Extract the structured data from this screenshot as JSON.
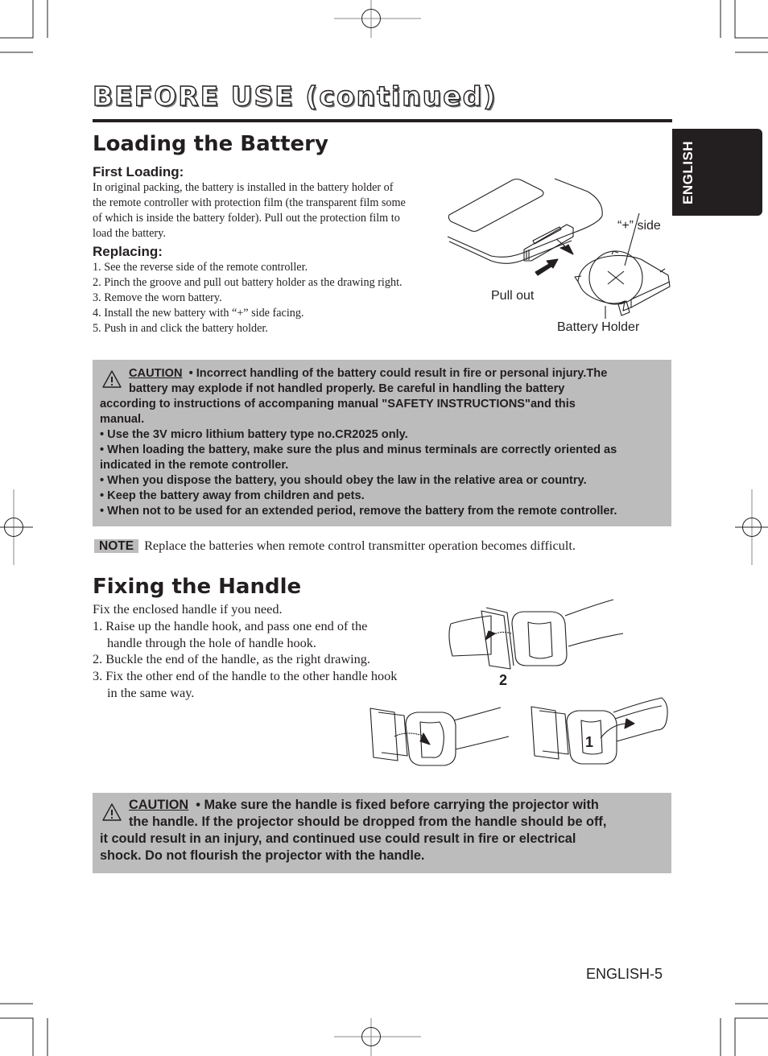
{
  "header": {
    "title": "BEFORE USE (continued)",
    "language_tab": "ENGLISH"
  },
  "battery_section": {
    "heading": "Loading the Battery",
    "first_loading": {
      "heading": "First Loading:",
      "lines": [
        "In original packing, the battery is installed in the battery holder of",
        "the remote controller with protection film (the transparent film some",
        "of which is inside the battery folder). Pull out the protection film  to",
        "load the battery."
      ]
    },
    "replacing": {
      "heading": "Replacing:",
      "steps": [
        "1. See the reverse side of the remote controller.",
        "2. Pinch the groove and pull out battery holder as the drawing right.",
        "3. Remove the worn battery.",
        "4. Install the new battery with “+” side facing.",
        "5. Push in and click the battery holder."
      ]
    },
    "figure": {
      "plus_side_label": "“+” side",
      "pull_out_label": "Pull out",
      "battery_holder_label": "Battery Holder"
    },
    "caution": {
      "label": "CAUTION",
      "lines": [
        "• Incorrect handling of the battery could result in fire or personal injury.The",
        "battery may explode if not handled properly. Be careful in handling the battery",
        "according to instructions of accompaning manual \"SAFETY INSTRUCTIONS\"and this",
        "manual.",
        "• Use the 3V micro lithium battery type no.CR2025 only.",
        "• When loading the battery, make sure the plus and minus terminals are correctly oriented as",
        "indicated in the remote controller.",
        "• When you dispose the battery, you should obey the law in the relative area or country.",
        "• Keep the battery away from children and pets.",
        "• When not to be used for an extended period, remove the battery from the remote controller."
      ]
    },
    "note": {
      "label": "NOTE",
      "text": "Replace the batteries when remote control transmitter operation becomes difficult."
    }
  },
  "handle_section": {
    "heading": "Fixing the Handle",
    "intro": "Fix the enclosed handle if you need.",
    "steps": [
      "1. Raise up the handle hook, and pass one end of the handle through the hole of handle hook.",
      "2. Buckle the end of the handle, as the right drawing.",
      "3. Fix the other end of the handle to the other handle hook in the same way."
    ],
    "figure": {
      "step_2_label": "2",
      "step_1_label": "1"
    },
    "caution": {
      "label": "CAUTION",
      "lines": [
        "• Make sure the handle is fixed before carrying the projector with",
        "the handle. If the projector should be dropped from the handle should be off,",
        "it could result in an injury, and continued use could result in fire or electrical",
        "shock. Do not flourish the projector with the handle."
      ]
    }
  },
  "footer": {
    "page_number": "ENGLISH-5"
  }
}
